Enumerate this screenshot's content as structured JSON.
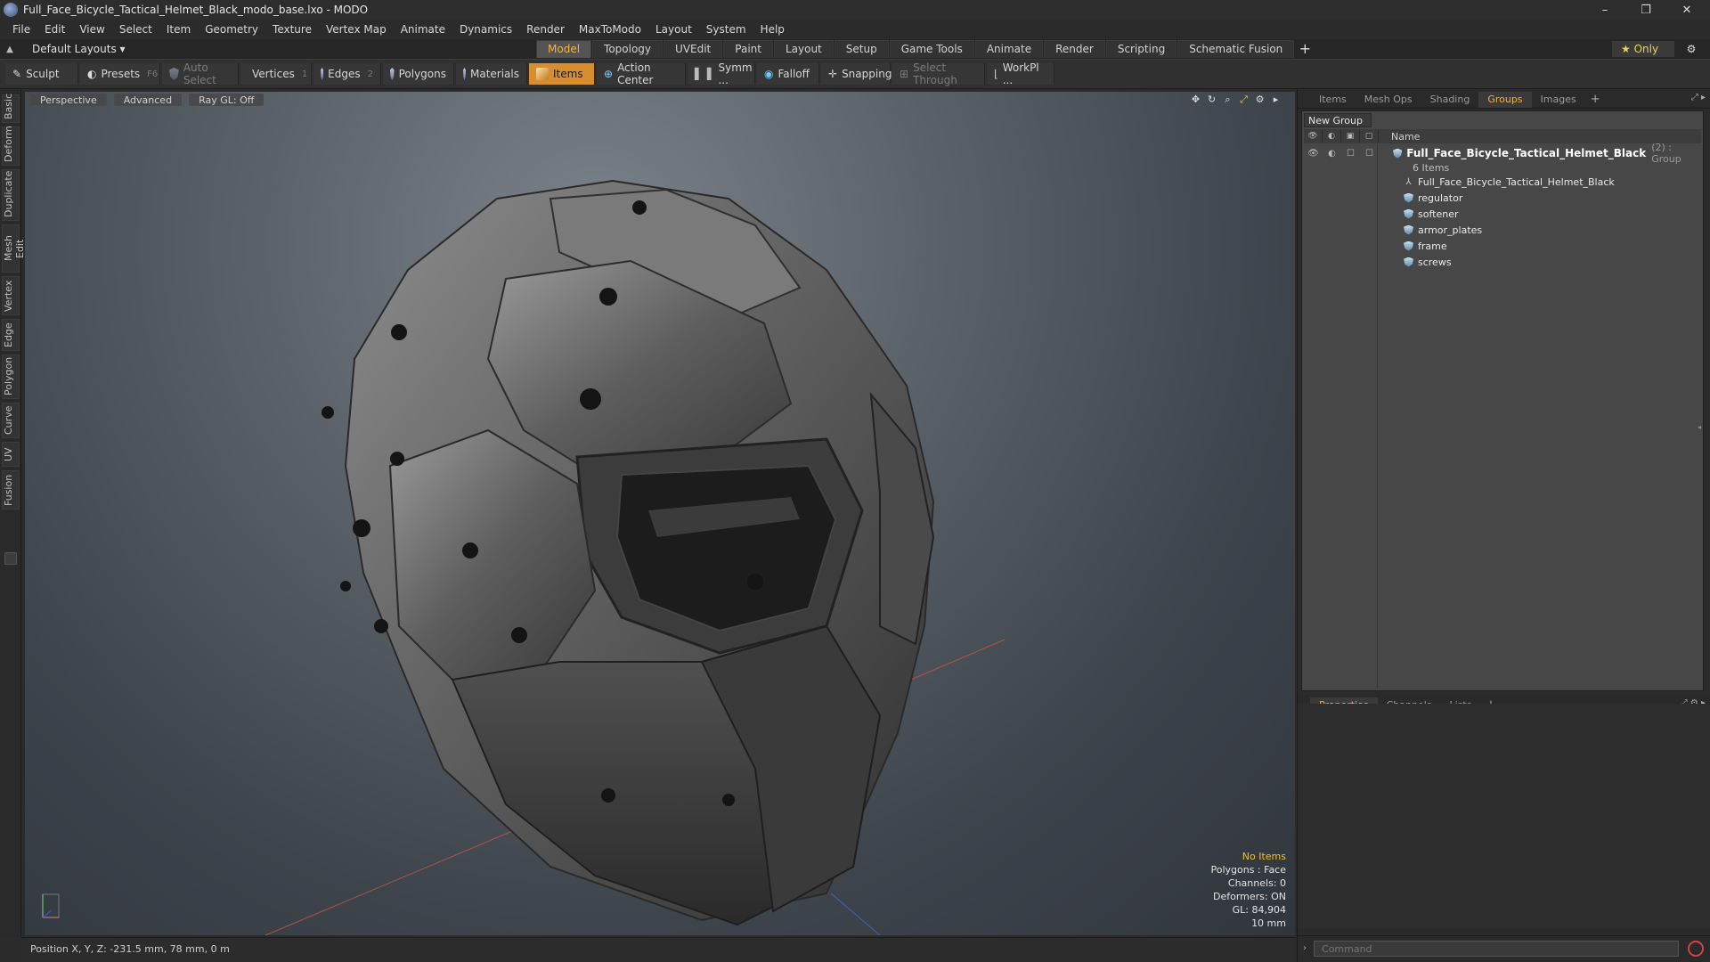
{
  "window": {
    "title": "Full_Face_Bicycle_Tactical_Helmet_Black_modo_base.lxo - MODO",
    "controls": [
      "–",
      "❐",
      "✕"
    ]
  },
  "menu": [
    "File",
    "Edit",
    "View",
    "Select",
    "Item",
    "Geometry",
    "Texture",
    "Vertex Map",
    "Animate",
    "Dynamics",
    "Render",
    "MaxToModo",
    "Layout",
    "System",
    "Help"
  ],
  "layoutbar": {
    "layouts_label": "Default Layouts ▾",
    "tabs": [
      "Model",
      "Topology",
      "UVEdit",
      "Paint",
      "Layout",
      "Setup",
      "Game Tools",
      "Animate",
      "Render",
      "Scripting",
      "Schematic Fusion"
    ],
    "active_tab": "Model",
    "add": "+",
    "only_label": "★  Only"
  },
  "toolbar": {
    "sculpt": "Sculpt",
    "presets": "Presets",
    "presets_key": "F6",
    "auto_select": "Auto Select",
    "vertices": "Vertices",
    "vertices_key": "1",
    "edges": "Edges",
    "edges_key": "2",
    "polygons": "Polygons",
    "materials": "Materials",
    "items": "Items",
    "action_center": "Action Center",
    "symmetry": "Symm ...",
    "falloff": "Falloff",
    "snapping": "Snapping",
    "select_through": "Select Through",
    "workplane": "WorkPl ..."
  },
  "left_tabs": [
    "Basic",
    "Deform",
    "Duplicate",
    "Mesh Edit",
    "Vertex",
    "Edge",
    "Polygon",
    "Curve",
    "UV",
    "Fusion"
  ],
  "viewport": {
    "view_mode": "Perspective",
    "shading": "Advanced",
    "raygl": "Ray GL: Off",
    "stats": {
      "no_items": "No Items",
      "polygons": "Polygons : Face",
      "channels": "Channels: 0",
      "deformers": "Deformers: ON",
      "gl": "GL: 84,904",
      "grid": "10 mm"
    }
  },
  "statusbar": {
    "position": "Position X, Y, Z:  -231.5 mm, 78 mm, 0 m"
  },
  "right_panel": {
    "top_tabs": [
      "Items",
      "Mesh Ops",
      "Shading",
      "Groups",
      "Images"
    ],
    "active_top_tab": "Groups",
    "new_group": "New Group",
    "column_name": "Name",
    "group": {
      "name": "Full_Face_Bicycle_Tactical_Helmet_Black",
      "type": "(2) : Group",
      "count": "6 Items",
      "children": [
        {
          "name": "Full_Face_Bicycle_Tactical_Helmet_Black",
          "icon": "locator-icon"
        },
        {
          "name": "regulator",
          "icon": "mesh-icon"
        },
        {
          "name": "softener",
          "icon": "mesh-icon"
        },
        {
          "name": "armor_plates",
          "icon": "mesh-icon"
        },
        {
          "name": "frame",
          "icon": "mesh-icon"
        },
        {
          "name": "screws",
          "icon": "mesh-icon"
        }
      ]
    },
    "bottom_tabs": [
      "Properties",
      "Channels",
      "Lists"
    ],
    "active_bottom_tab": "Properties",
    "command_placeholder": "Command"
  }
}
